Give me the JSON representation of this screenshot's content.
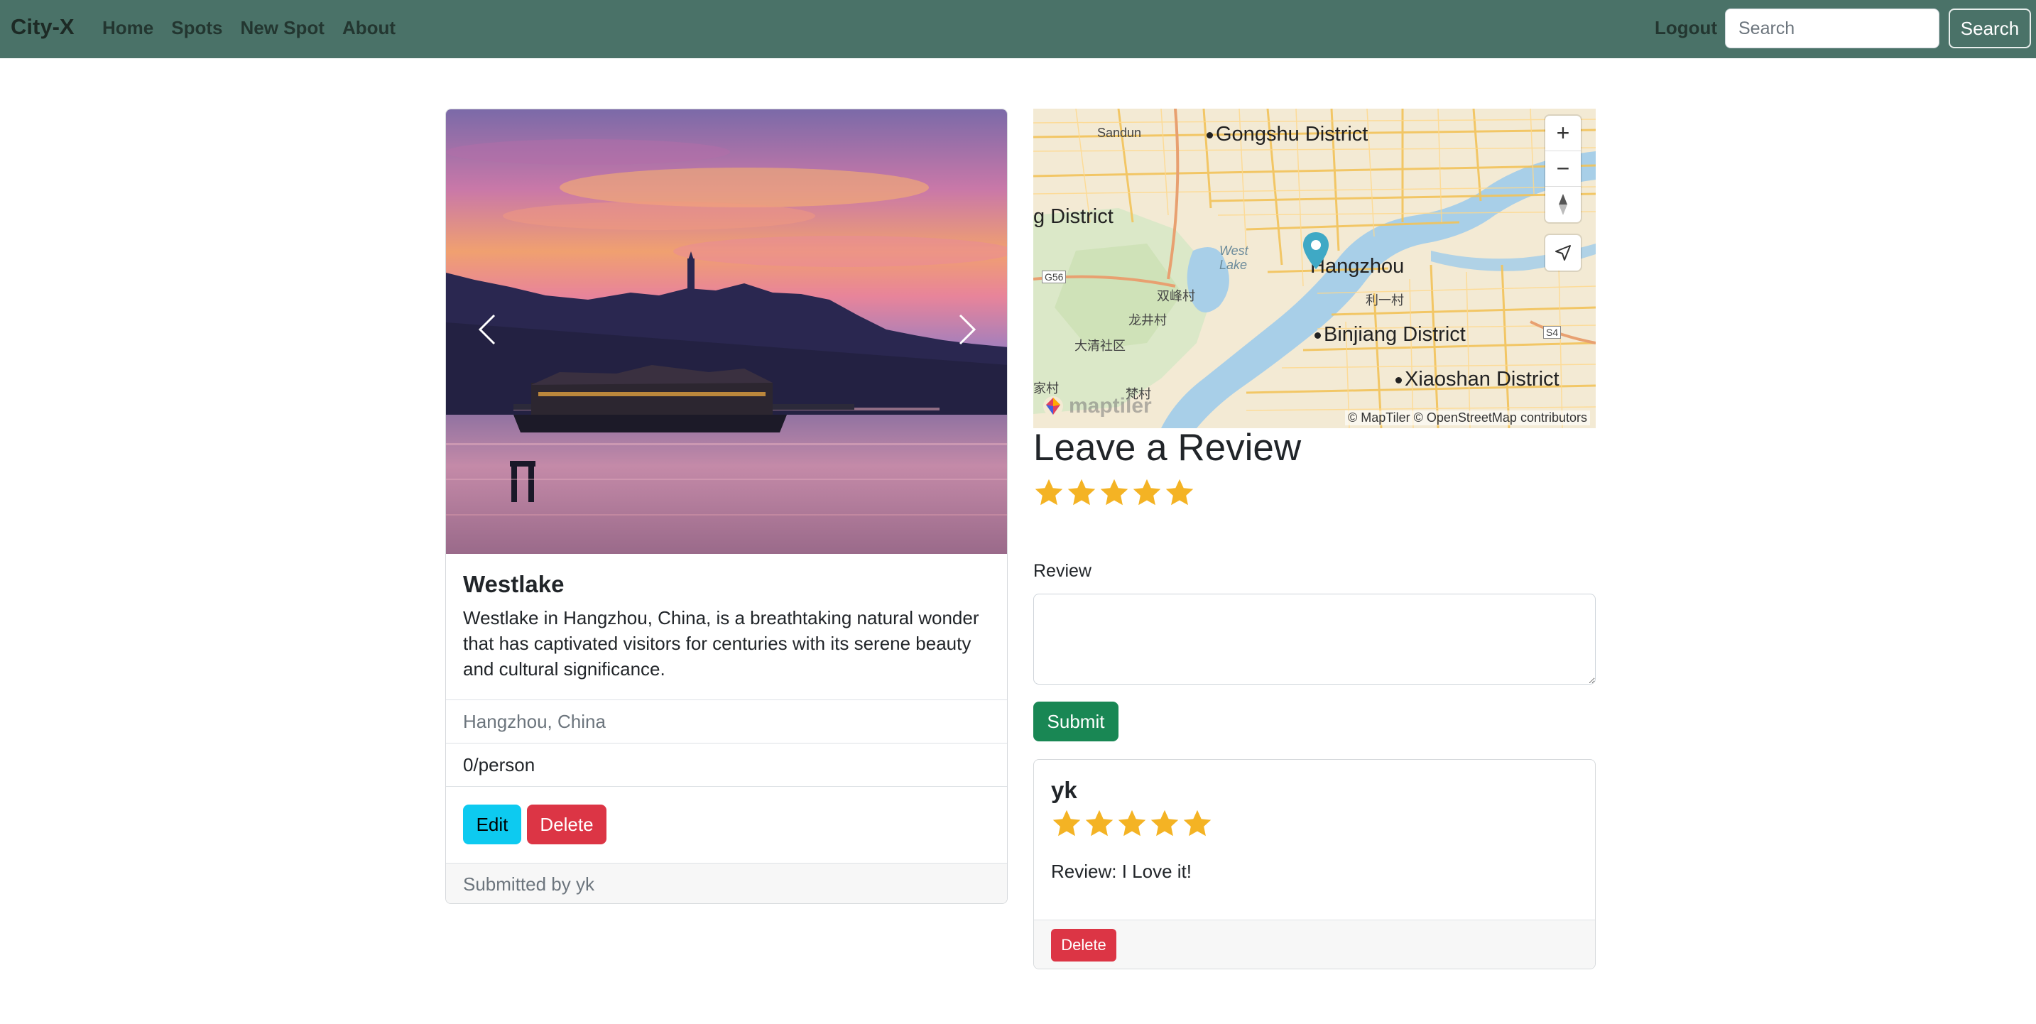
{
  "navbar": {
    "brand": "City-X",
    "links": [
      "Home",
      "Spots",
      "New Spot",
      "About"
    ],
    "logout": "Logout",
    "search_placeholder": "Search",
    "search_button": "Search"
  },
  "spot": {
    "title": "Westlake",
    "description": "Westlake in Hangzhou, China, is a breathtaking natural wonder that has captivated visitors for centuries with its serene beauty and cultural significance.",
    "location": "Hangzhou, China",
    "price": "0/person",
    "edit_label": "Edit",
    "delete_label": "Delete",
    "submitted_by": "Submitted by yk"
  },
  "map": {
    "labels": {
      "gongshu": "Gongshu District",
      "g_district": "g District",
      "hangzhou": "Hangzhou",
      "binjiang": "Binjiang District",
      "xiaoshan": "Xiaoshan District",
      "sandun": "Sandun",
      "west_lake": "West Lake",
      "shuangfeng": "双峰村",
      "longjing": "龙井村",
      "daqing": "大清社区",
      "liyi": "利一村",
      "fancun": "梵村",
      "jiacun": "家村",
      "g56": "G56",
      "s4": "S4"
    },
    "logo": "maptiler",
    "attribution": "© MapTiler © OpenStreetMap contributors",
    "zoom_in": "+",
    "zoom_out": "−"
  },
  "review_form": {
    "heading": "Leave a Review",
    "rating": 5,
    "label": "Review",
    "submit_label": "Submit"
  },
  "reviews": [
    {
      "author": "yk",
      "rating": 5,
      "text": "Review: I Love it!",
      "delete_label": "Delete"
    }
  ],
  "colors": {
    "navbar": "#4a7268",
    "star": "#f4b324",
    "edit": "#0dcaf0",
    "delete": "#dc3545",
    "submit": "#198754",
    "marker": "#3fa9c5"
  }
}
